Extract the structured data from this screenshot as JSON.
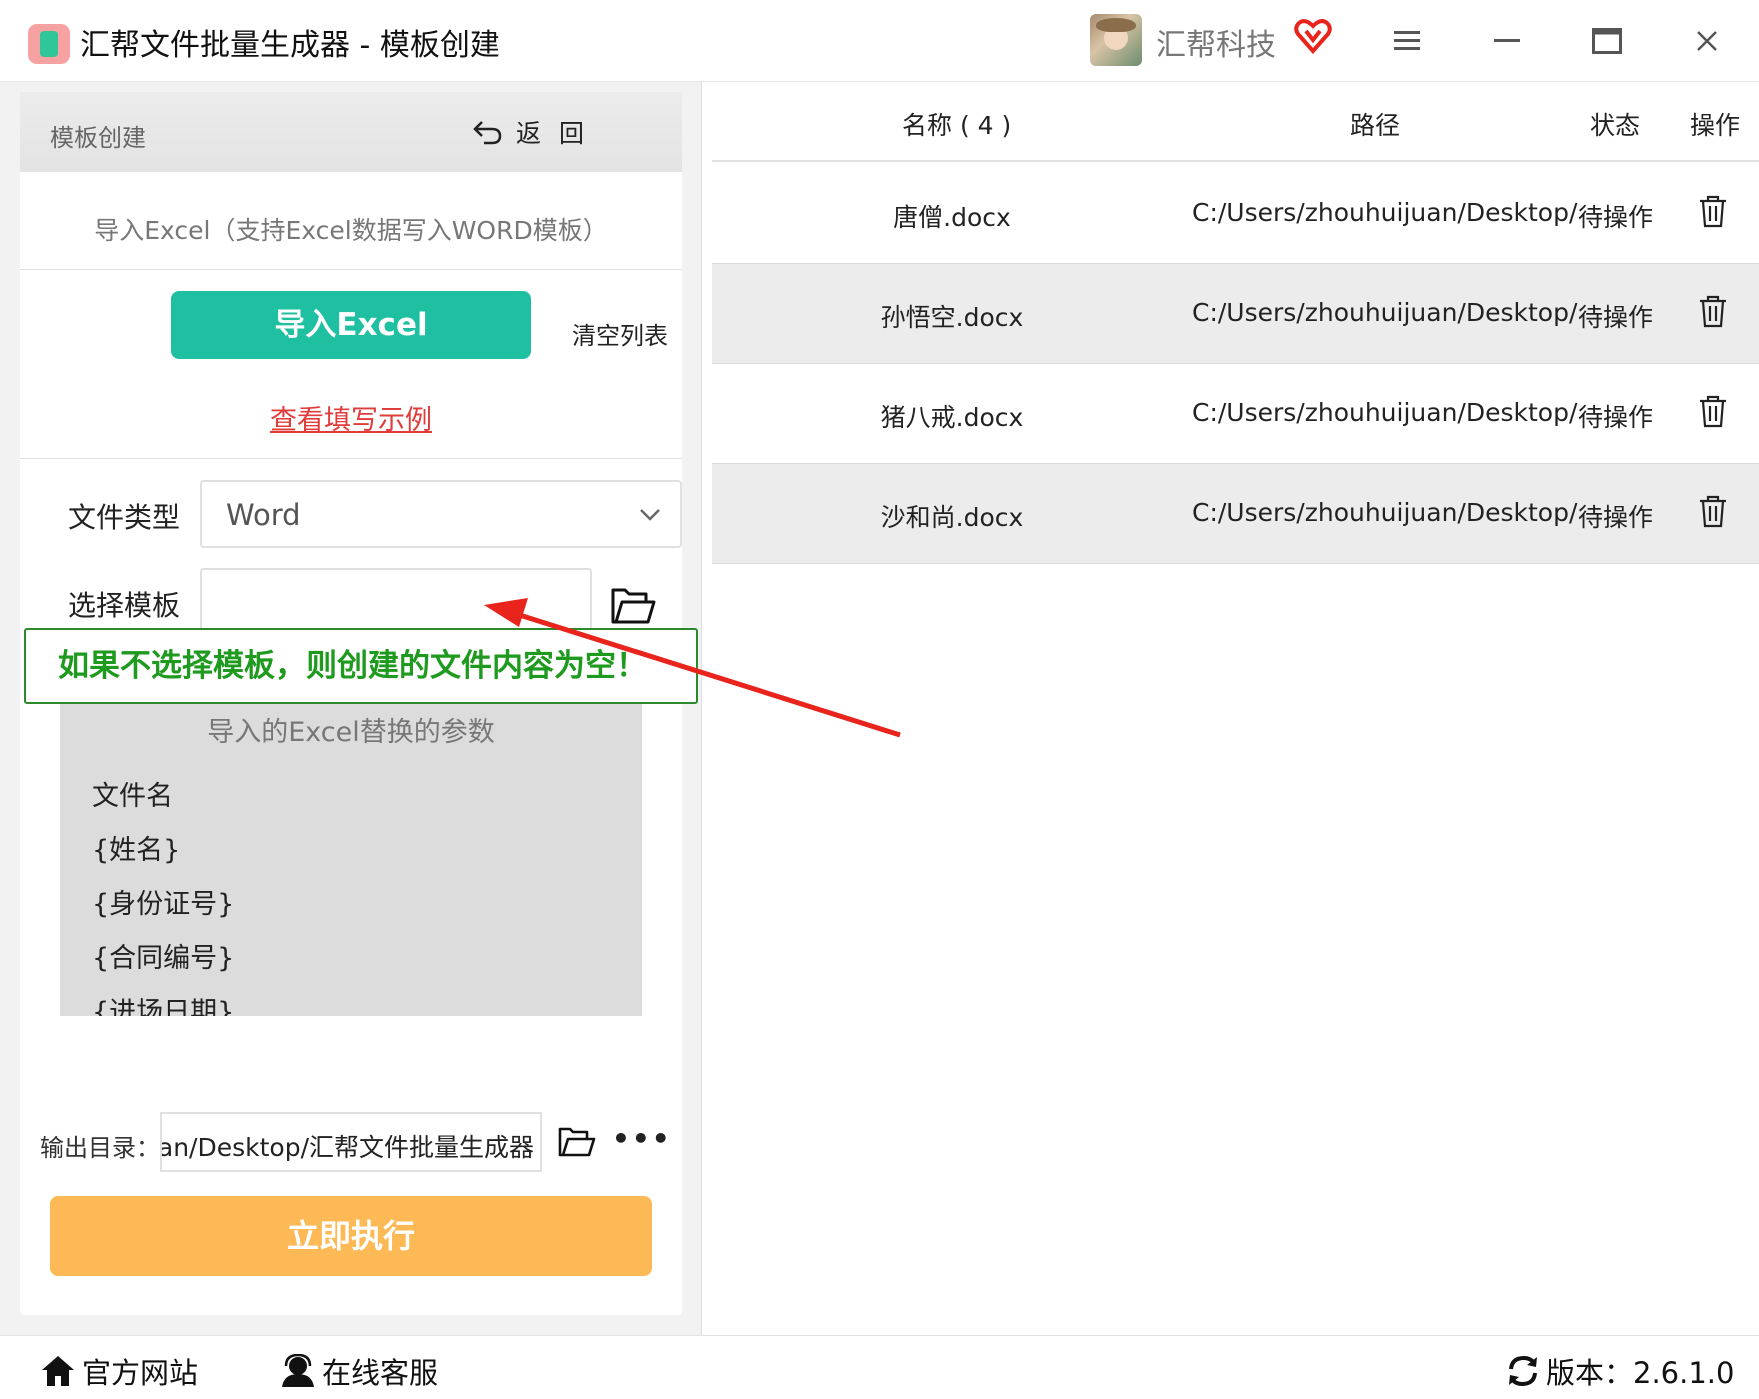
{
  "titlebar": {
    "title": "汇帮文件批量生成器 - 模板创建",
    "user_name": "汇帮科技",
    "icons": [
      "app-logo-icon",
      "avatar",
      "vip-heart-icon",
      "menu-icon",
      "minimize-icon",
      "maximize-icon",
      "close-icon"
    ]
  },
  "left": {
    "header_title": "模板创建",
    "back_label": "返回",
    "import_hint": "导入Excel（支持Excel数据写入WORD模板）",
    "import_button": "导入Excel",
    "clear_list": "清空列表",
    "example_link": "查看填写示例",
    "file_type_label": "文件类型",
    "file_type_value": "Word",
    "template_label": "选择模板",
    "template_value": "",
    "notice": "如果不选择模板，则创建的文件内容为空！",
    "params_title": "导入的Excel替换的参数",
    "params": [
      "文件名",
      "{姓名}",
      "{身份证号}",
      "{合同编号}",
      "{进场日期}"
    ],
    "output_label": "输出目录：",
    "output_value": "uan/Desktop/汇帮文件批量生成器",
    "run_button": "立即执行"
  },
  "table": {
    "headers": {
      "name": "名称 ( 4 )",
      "path": "路径",
      "status": "状态",
      "op": "操作"
    },
    "rows": [
      {
        "name": "唐僧.docx",
        "path": "C:/Users/zhouhuijuan/Desktop/",
        "status": "待操作"
      },
      {
        "name": "孙悟空.docx",
        "path": "C:/Users/zhouhuijuan/Desktop/",
        "status": "待操作"
      },
      {
        "name": "猪八戒.docx",
        "path": "C:/Users/zhouhuijuan/Desktop/",
        "status": "待操作"
      },
      {
        "name": "沙和尚.docx",
        "path": "C:/Users/zhouhuijuan/Desktop/",
        "status": "待操作"
      }
    ]
  },
  "statusbar": {
    "website": "官方网站",
    "support": "在线客服",
    "version": "版本：2.6.1.0"
  },
  "colors": {
    "import_button": "#1fbfa2",
    "run_button": "#fcb955",
    "link_red": "#e13b3b",
    "notice_green": "#1e9a1e",
    "arrow_red": "#e8241c"
  }
}
